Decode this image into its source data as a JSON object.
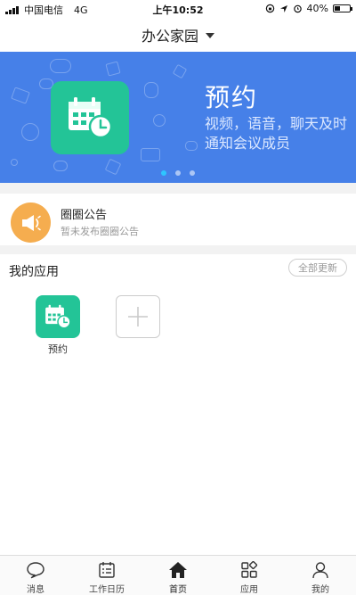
{
  "status_bar": {
    "carrier": "中国电信",
    "network": "4G",
    "time": "上午10:52",
    "battery": "40%",
    "battery_level": 0.4
  },
  "nav": {
    "title": "办公家园"
  },
  "banner": {
    "title": "预约",
    "subtitle": "视频，语音，聊天及时通知会议成员",
    "slide_count": 3,
    "active_slide": 1
  },
  "announcement": {
    "title": "圈圈公告",
    "subtitle": "暂未发布圈圈公告"
  },
  "apps": {
    "section_title": "我的应用",
    "update_all_label": "全部更新",
    "items": [
      {
        "label": "预约",
        "icon": "calendar-clock-icon"
      }
    ]
  },
  "tabs": [
    {
      "label": "消息",
      "icon": "chat-bubble-icon"
    },
    {
      "label": "工作日历",
      "icon": "work-calendar-icon"
    },
    {
      "label": "首页",
      "icon": "home-icon",
      "active": true
    },
    {
      "label": "应用",
      "icon": "apps-grid-icon"
    },
    {
      "label": "我的",
      "icon": "person-icon"
    }
  ],
  "colors": {
    "banner_bg": "#4680e8",
    "app_green": "#23c497",
    "announce_orange": "#f5ad4f",
    "dot_active": "#2ec5ff"
  }
}
